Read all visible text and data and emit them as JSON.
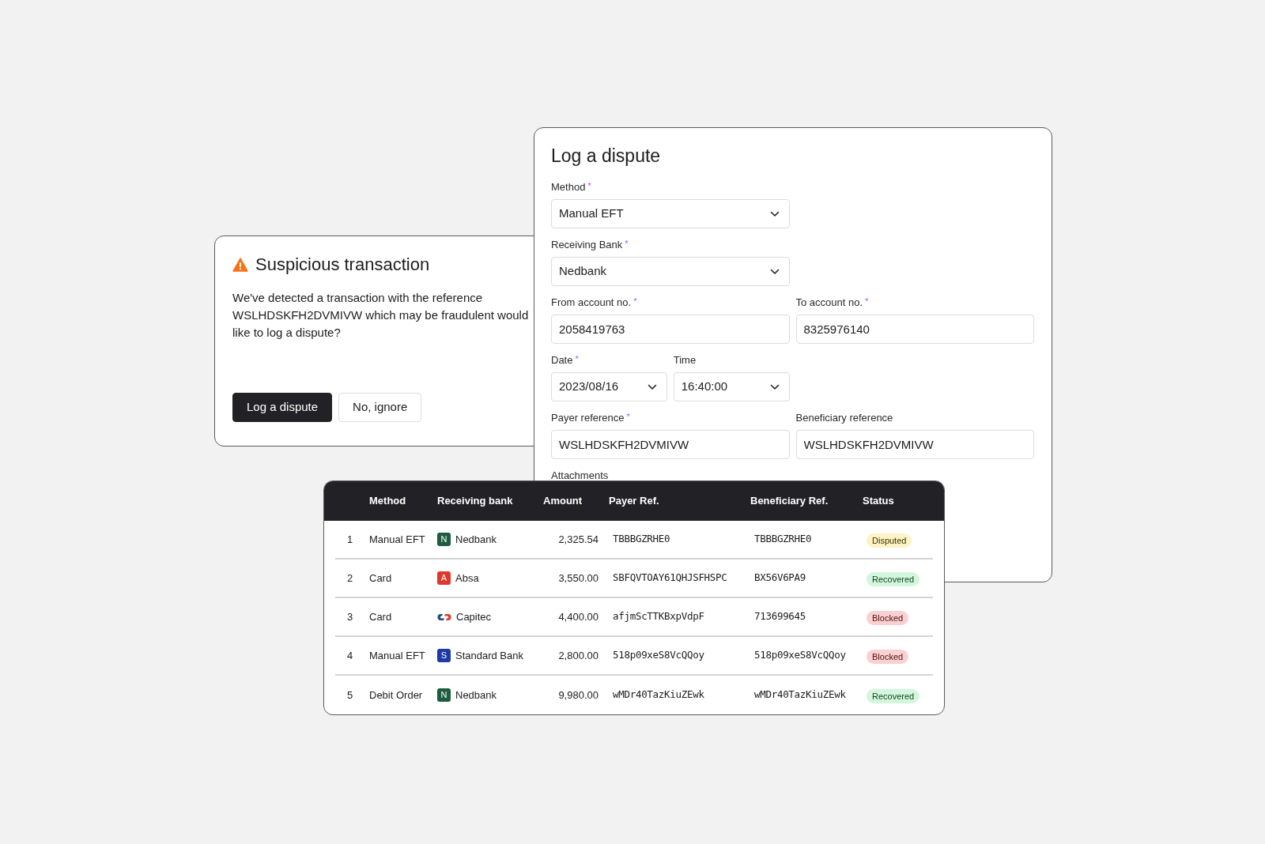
{
  "alert": {
    "title": "Suspicious transaction",
    "message_lines": [
      "We've detected a transaction with the reference",
      "WSLHDSKFH2DVMIVW which may be fraudulent would",
      "like to log a dispute?"
    ],
    "buttons": [
      {
        "label": "Log a dispute",
        "kind": "primary"
      },
      {
        "label": "No, ignore",
        "kind": "secondary"
      }
    ]
  },
  "dispute_form": {
    "title": "Log a dispute",
    "rows": [
      [
        {
          "label": "Method",
          "required_mark": "*",
          "kind": "select",
          "value": "Manual EFT"
        }
      ],
      [
        {
          "label": "Receiving Bank",
          "required_mark": "*",
          "kind": "select",
          "value": "Nedbank"
        }
      ],
      [
        {
          "label": "From account no.",
          "required_mark": "*",
          "kind": "text",
          "value": "2058419763"
        },
        {
          "label": "To account no.",
          "required_mark": "*",
          "kind": "text",
          "value": "8325976140"
        }
      ],
      [
        {
          "label": "Date",
          "required_mark": "*",
          "kind": "select",
          "value": "2023/08/16"
        },
        {
          "label": "Time",
          "kind": "select",
          "value": "16:40:00"
        }
      ],
      [
        {
          "label": "Payer reference",
          "required_mark": "*",
          "kind": "text",
          "value": "WSLHDSKFH2DVMIVW"
        },
        {
          "label": "Beneficiary reference",
          "kind": "text",
          "value": "WSLHDSKFH2DVMIVW"
        }
      ]
    ],
    "attachments_label": "Attachments"
  },
  "table": {
    "columns": [
      "",
      "Method",
      "Receiving bank",
      "Amount",
      "Payer Ref.",
      "Beneficiary Ref.",
      "Status"
    ],
    "rows": [
      {
        "number": "1",
        "method": "Manual EFT",
        "bank": {
          "kind": "letter",
          "letter": "N",
          "color": "#1e5c3f",
          "name": "Nedbank"
        },
        "amount": "2,325.54",
        "payer_ref": "TBBBGZRHE0",
        "beneficiary_ref": "TBBBGZRHE0",
        "status": {
          "label": "Disputed",
          "kind": "warning"
        }
      },
      {
        "number": "2",
        "method": "Card",
        "bank": {
          "kind": "letter",
          "letter": "A",
          "color": "#e0382f",
          "name": "Absa"
        },
        "amount": "3,550.00",
        "payer_ref": "SBFQVTOAY61QHJSFHSPC",
        "beneficiary_ref": "BX56V6PA9",
        "status": {
          "label": "Recovered",
          "kind": "success"
        }
      },
      {
        "number": "3",
        "method": "Card",
        "bank": {
          "kind": "capitec",
          "name": "Capitec"
        },
        "amount": "4,400.00",
        "payer_ref": "afjmScTTKBxpVdpF",
        "beneficiary_ref": "713699645",
        "status": {
          "label": "Blocked",
          "kind": "danger"
        }
      },
      {
        "number": "4",
        "method": "Manual EFT",
        "bank": {
          "kind": "letter",
          "letter": "S",
          "color": "#1d3aa6",
          "name": "Standard Bank"
        },
        "amount": "2,800.00",
        "payer_ref": "518p09xeS8VcQQoy",
        "beneficiary_ref": "518p09xeS8VcQQoy",
        "status": {
          "label": "Blocked",
          "kind": "danger"
        }
      },
      {
        "number": "5",
        "method": "Debit Order",
        "bank": {
          "kind": "letter",
          "letter": "N",
          "color": "#1e5c3f",
          "name": "Nedbank"
        },
        "amount": "9,980.00",
        "payer_ref": "wMDr40TazKiuZEwk",
        "beneficiary_ref": "wMDr40TazKiuZEwk",
        "status": {
          "label": "Recovered",
          "kind": "success"
        }
      }
    ]
  }
}
